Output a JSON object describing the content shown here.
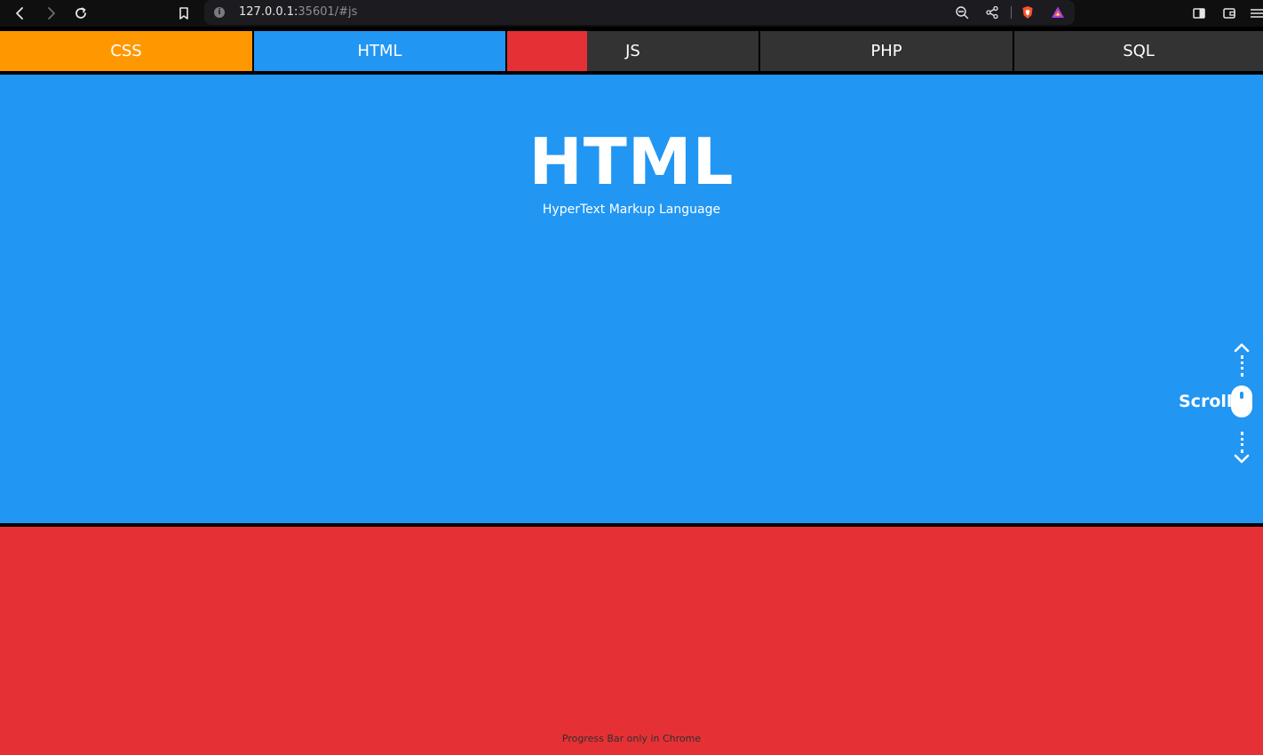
{
  "browser": {
    "url_host": "127.0.0.1:",
    "url_rest": "35601/#js"
  },
  "nav": {
    "tabs": [
      {
        "label": "CSS",
        "color": "#ff9800"
      },
      {
        "label": "HTML",
        "color": "#2196f3"
      },
      {
        "label": "JS",
        "color": "#333333"
      },
      {
        "label": "PHP",
        "color": "#333333"
      },
      {
        "label": "SQL",
        "color": "#333333"
      }
    ],
    "active_indicator_color": "#e53135"
  },
  "hero": {
    "title": "HTML",
    "subtitle": "HyperText Markup Language",
    "background": "#2196f3"
  },
  "next_section": {
    "background": "#e53135"
  },
  "scroll_indicator": {
    "label": "Scroll"
  },
  "footer": {
    "note": "Progress Bar only in Chrome"
  },
  "icons": [
    "back-icon",
    "forward-icon",
    "reload-icon",
    "bookmark-icon",
    "info-icon",
    "zoom-out-icon",
    "share-icon",
    "brave-shield-icon",
    "brave-rewards-icon",
    "sidebar-icon",
    "wallet-icon",
    "menu-icon",
    "mouse-icon"
  ]
}
